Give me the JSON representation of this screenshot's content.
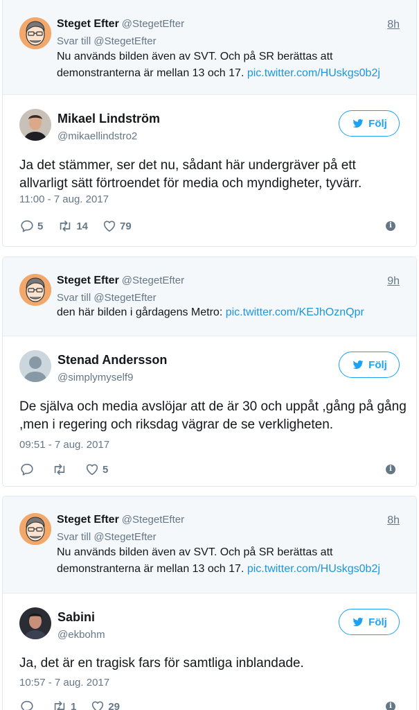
{
  "threads": [
    {
      "parent": {
        "name": "Steget Efter",
        "handle": "@StegetEfter",
        "time": "8h",
        "reply_to": "Svar till @StegetEfter",
        "text": "Nu används bilden även av SVT. Och på SR berättas att demonstranterna är mellan 13 och 17.",
        "link": "pic.twitter.com/HUskgs0b2j"
      },
      "tweet": {
        "name": "Mikael Lindström",
        "handle": "@mikaellindstro2",
        "follow_label": "Följ",
        "text": "Ja det stämmer, ser det nu, sådant här undergräver på ett allvarligt sätt förtroendet för media och myndigheter, tyvärr.",
        "timestamp": "11:00 - 7 aug. 2017",
        "replies": "5",
        "retweets": "14",
        "likes": "79"
      }
    },
    {
      "parent": {
        "name": "Steget Efter",
        "handle": "@StegetEfter",
        "time": "9h",
        "reply_to": "Svar till @StegetEfter",
        "text": "den här bilden i gårdagens Metro:",
        "link": "pic.twitter.com/KEJhOznQpr"
      },
      "tweet": {
        "name": "Stenad Andersson",
        "handle": "@simplymyself9",
        "follow_label": "Följ",
        "text": "De själva och media avslöjar att de är 30 och uppåt ,gång på gång ,men i regering och riksdag vägrar de se verkligheten.",
        "timestamp": "09:51 - 7 aug. 2017",
        "replies": "",
        "retweets": "",
        "likes": "5"
      }
    },
    {
      "parent": {
        "name": "Steget Efter",
        "handle": "@StegetEfter",
        "time": "8h",
        "reply_to": "Svar till @StegetEfter",
        "text": "Nu används bilden även av SVT. Och på SR berättas att demonstranterna är mellan 13 och 17.",
        "link": "pic.twitter.com/HUskgs0b2j"
      },
      "tweet": {
        "name": "Sabini",
        "handle": "@ekbohm",
        "follow_label": "Följ",
        "text": "Ja, det är en tragisk fars för samtliga inblandade.",
        "timestamp": "10:57 - 7 aug. 2017",
        "replies": "",
        "retweets": "1",
        "likes": "29"
      }
    }
  ],
  "icons": {
    "reply": "reply-icon",
    "retweet": "retweet-icon",
    "like": "heart-icon",
    "info": "info-icon",
    "bird": "twitter-bird-icon"
  },
  "colors": {
    "accent": "#1da1f2",
    "link": "#1b95e0",
    "muted": "#657786",
    "parent_bg": "#f5f8fa",
    "avatar_orange": "#f3a86b"
  }
}
